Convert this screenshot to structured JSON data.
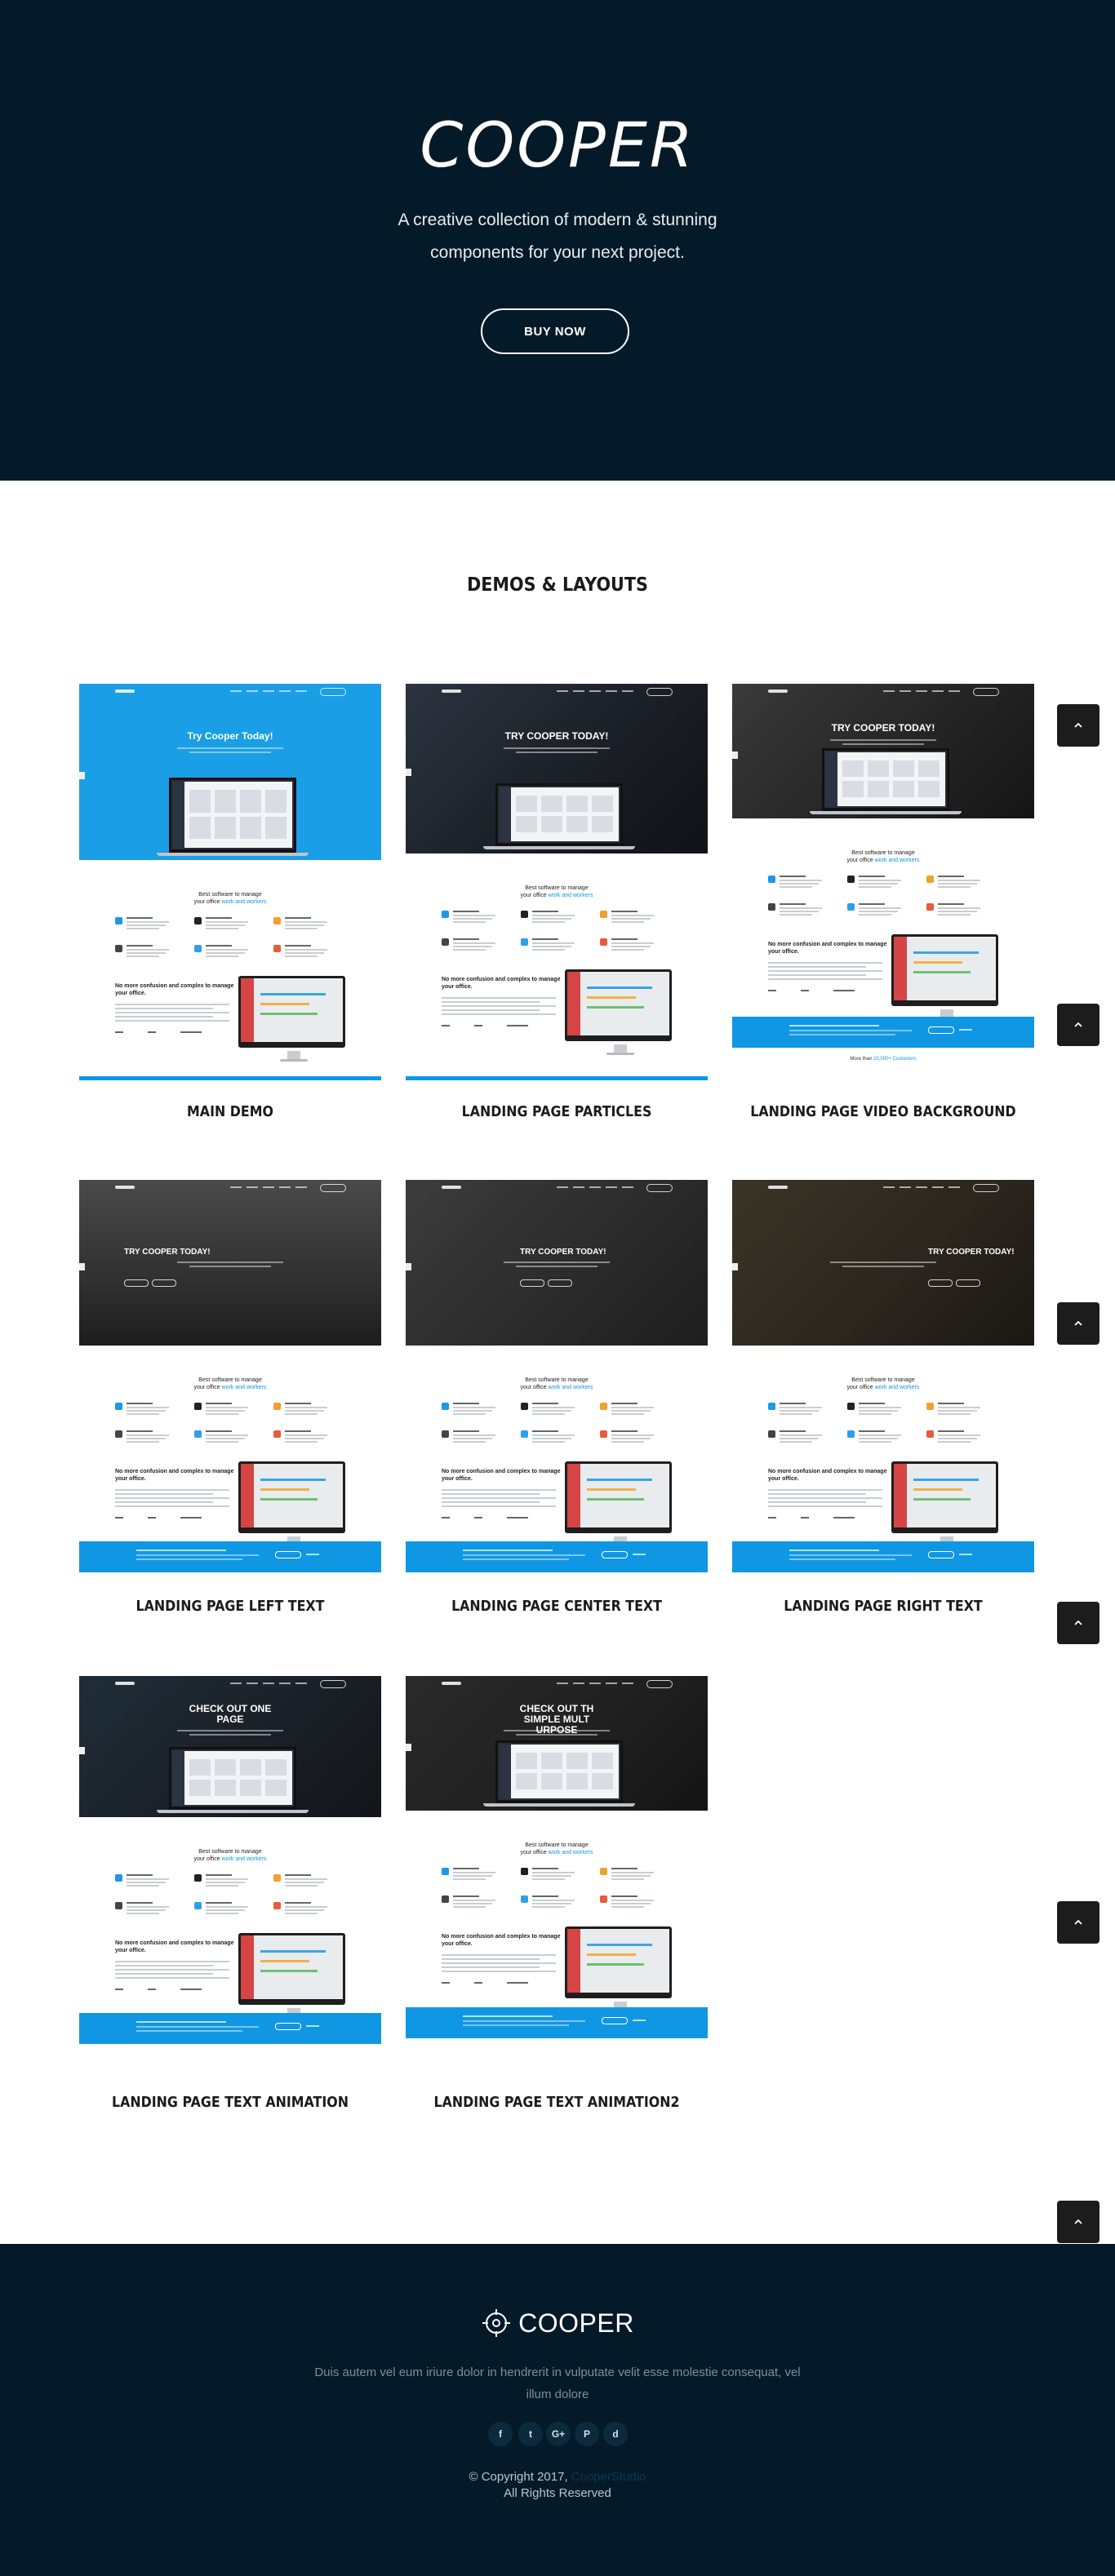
{
  "hero": {
    "brand": "COOPER",
    "tagline": "A creative collection of modern & stunning components for your next project.",
    "buy_label": "BUY NOW"
  },
  "demos": {
    "title": "DEMOS & LAYOUTS",
    "items": [
      {
        "label": "MAIN DEMO",
        "hero_title": "Try Cooper Today!"
      },
      {
        "label": "LANDING PAGE PARTICLES",
        "hero_title": "TRY COOPER TODAY!"
      },
      {
        "label": "LANDING PAGE VIDEO BACKGROUND",
        "hero_title": "TRY COOPER TODAY!"
      },
      {
        "label": "LANDING PAGE LEFT TEXT",
        "hero_title": "TRY COOPER TODAY!"
      },
      {
        "label": "LANDING PAGE CENTER TEXT",
        "hero_title": "TRY COOPER TODAY!"
      },
      {
        "label": "LANDING PAGE RIGHT TEXT",
        "hero_title": "TRY COOPER TODAY!"
      },
      {
        "label": "LANDING PAGE TEXT ANIMATION",
        "hero_title": "CHECK OUT ONE PAGE"
      },
      {
        "label": "LANDING PAGE TEXT ANIMATION2",
        "hero_title": "CHECK OUT TH SIMPLE MULT URPOSE"
      }
    ],
    "thumb_text": {
      "best_pre": "Best software to manage",
      "best_mid": "your office",
      "best_em": "work and workers",
      "mid_heading": "No more confusion and complex to manage your office.",
      "foot_pre": "More than",
      "foot_em": "10,000+ Customers",
      "foot_post": "use Cooper Admin Kit"
    }
  },
  "footer": {
    "brand": "COOPER",
    "description": "Duis autem vel eum iriure dolor in hendrerit in vulputate velit esse molestie consequat, vel illum dolore",
    "social": [
      {
        "icon": "facebook-icon",
        "glyph": "f"
      },
      {
        "icon": "twitter-icon",
        "glyph": "t"
      },
      {
        "icon": "google-plus-icon",
        "glyph": "G+"
      },
      {
        "icon": "pinterest-icon",
        "glyph": "P"
      },
      {
        "icon": "dribbble-icon",
        "glyph": "d"
      }
    ],
    "copyright": "© Copyright 2017,",
    "copyright_link": "CooperStudio",
    "rights": "All Rights Reserved"
  },
  "colors": {
    "navy": "#051a28",
    "accent_blue": "#1097e4",
    "hero_blue": "#1a9ee6"
  }
}
